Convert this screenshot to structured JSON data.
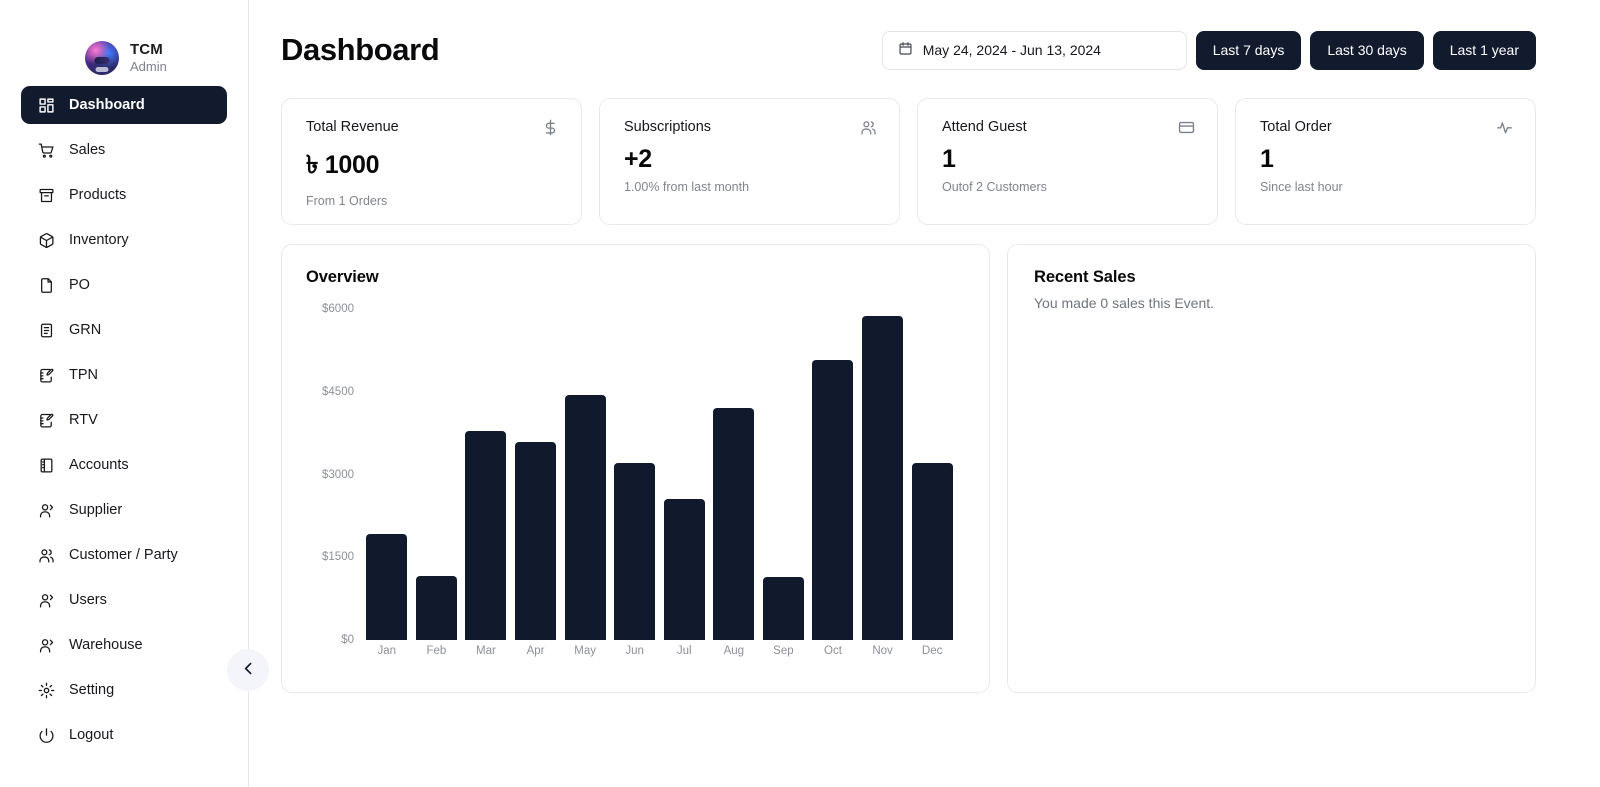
{
  "sidebar": {
    "brand": {
      "name": "TCM",
      "role": "Admin",
      "avatar_icon": "user-avatar"
    },
    "items": [
      {
        "label": "Dashboard",
        "icon": "grid-icon",
        "active": true
      },
      {
        "label": "Sales",
        "icon": "shopping-cart-icon",
        "active": false
      },
      {
        "label": "Products",
        "icon": "archive-box-icon",
        "active": false
      },
      {
        "label": "Inventory",
        "icon": "cube-icon",
        "active": false
      },
      {
        "label": "PO",
        "icon": "file-icon",
        "active": false
      },
      {
        "label": "GRN",
        "icon": "clipboard-list-icon",
        "active": false
      },
      {
        "label": "TPN",
        "icon": "notebook-pen-icon",
        "active": false
      },
      {
        "label": "RTV",
        "icon": "notebook-pen-icon",
        "active": false
      },
      {
        "label": "Accounts",
        "icon": "book-icon",
        "active": false
      },
      {
        "label": "Supplier",
        "icon": "user-icon",
        "active": false
      },
      {
        "label": "Customer / Party",
        "icon": "users-icon",
        "active": false
      },
      {
        "label": "Users",
        "icon": "user-icon",
        "active": false
      },
      {
        "label": "Warehouse",
        "icon": "user-icon",
        "active": false
      },
      {
        "label": "Setting",
        "icon": "gear-icon",
        "active": false
      },
      {
        "label": "Logout",
        "icon": "power-icon",
        "active": false
      }
    ],
    "collapse_icon": "chevron-left-icon"
  },
  "header": {
    "title": "Dashboard",
    "date_range": {
      "value": "May 24, 2024 - Jun 13, 2024",
      "icon": "calendar-icon"
    },
    "buttons": [
      {
        "label": "Last 7 days"
      },
      {
        "label": "Last 30 days"
      },
      {
        "label": "Last 1 year"
      }
    ]
  },
  "stats": [
    {
      "title": "Total Revenue",
      "value": "৳ 1000",
      "sub": "From 1 Orders",
      "icon": "dollar-sign-icon"
    },
    {
      "title": "Subscriptions",
      "value": "+2",
      "sub": "1.00% from last month",
      "icon": "users-icon"
    },
    {
      "title": "Attend Guest",
      "value": "1",
      "sub": "Outof 2 Customers",
      "icon": "credit-card-icon"
    },
    {
      "title": "Total Order",
      "value": "1",
      "sub": "Since last hour",
      "icon": "activity-icon"
    }
  ],
  "overview": {
    "title": "Overview"
  },
  "recent_sales": {
    "title": "Recent Sales",
    "subtitle": "You made 0 sales this Event."
  },
  "colors": {
    "accent_dark": "#121a2e",
    "bar": "#111a2d",
    "border": "#e8eaee",
    "muted_text": "#8c9098"
  },
  "chart_data": {
    "type": "bar",
    "title": "Overview",
    "xlabel": "",
    "ylabel": "",
    "categories": [
      "Jan",
      "Feb",
      "Mar",
      "Apr",
      "May",
      "Jun",
      "Jul",
      "Aug",
      "Sep",
      "Oct",
      "Nov",
      "Dec"
    ],
    "values": [
      1930,
      1165,
      3780,
      3590,
      4450,
      3210,
      2560,
      4200,
      1150,
      5080,
      5870,
      3210
    ],
    "ylim": [
      0,
      6000
    ],
    "ytick_values": [
      0,
      1500,
      3000,
      4500,
      6000
    ],
    "ytick_labels": [
      "$0",
      "$1500",
      "$3000",
      "$4500",
      "$6000"
    ],
    "grid": false,
    "legend": false
  }
}
